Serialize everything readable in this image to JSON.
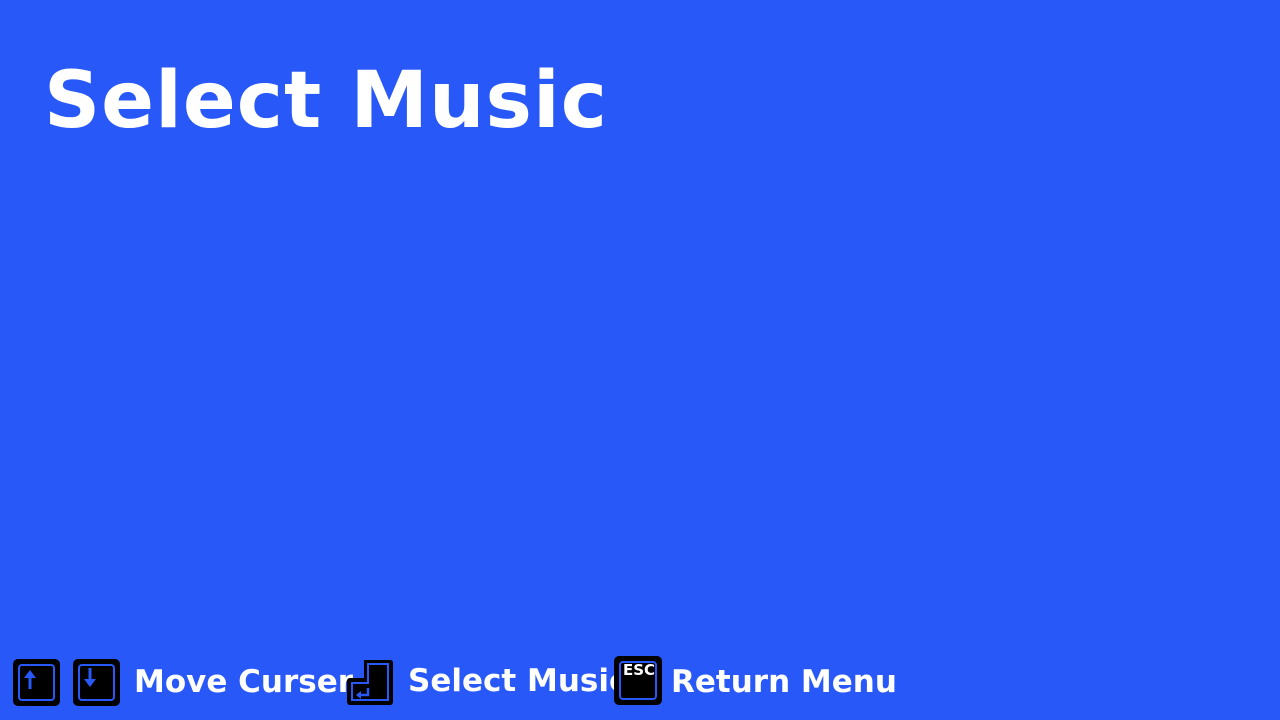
{
  "screen": {
    "title": "Select Music",
    "background_color": "#2858f8"
  },
  "hints": [
    {
      "keys": [
        "up-arrow-key-icon",
        "down-arrow-key-icon"
      ],
      "label": "Move Curser"
    },
    {
      "keys": [
        "enter-key-icon"
      ],
      "label": "Select Music"
    },
    {
      "keys": [
        "esc-key-icon"
      ],
      "label": "Return Menu",
      "key_text": "ESC"
    }
  ]
}
